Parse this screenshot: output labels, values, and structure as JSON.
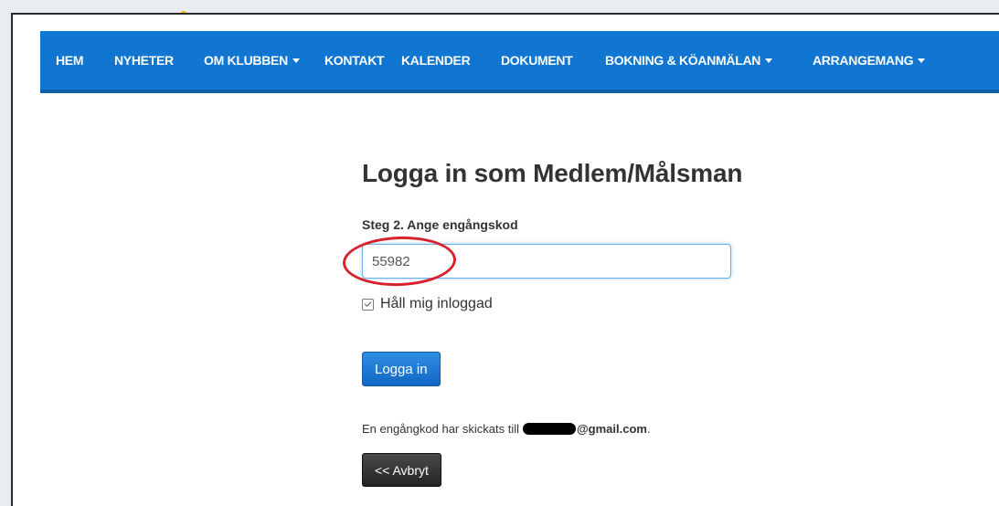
{
  "navbar": {
    "items": [
      {
        "label": "HEM",
        "has_dropdown": false
      },
      {
        "label": "NYHETER",
        "has_dropdown": false
      },
      {
        "label": "OM KLUBBEN",
        "has_dropdown": true
      },
      {
        "label": "KONTAKT",
        "has_dropdown": false
      },
      {
        "label": "KALENDER",
        "has_dropdown": false
      },
      {
        "label": "DOKUMENT",
        "has_dropdown": false
      },
      {
        "label": "BOKNING & KÖANMÄLAN",
        "has_dropdown": true
      },
      {
        "label": "ARRANGEMANG",
        "has_dropdown": true
      }
    ]
  },
  "login": {
    "title": "Logga in som Medlem/Målsman",
    "step_label": "Steg 2. Ange engångskod",
    "code_value": "55982",
    "remember_label": "Håll mig inloggad",
    "remember_checked": true,
    "submit_label": "Logga in",
    "sent_message_prefix": "En engångkod har skickats till",
    "sent_email_domain": "@gmail.com",
    "sent_message_suffix": ".",
    "cancel_label": "<< Avbryt"
  },
  "colors": {
    "navbar": "#1176d1",
    "annotation_circle": "#d7212e",
    "primary_button": "#1267c3",
    "dark_button": "#232323"
  }
}
